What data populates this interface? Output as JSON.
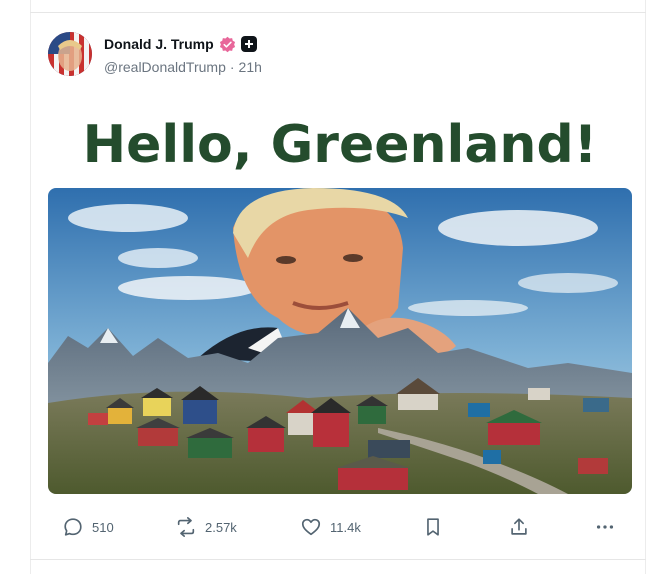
{
  "post": {
    "author": {
      "display_name": "Donald J. Trump",
      "handle": "@realDonaldTrump",
      "separator": "·",
      "time": "21h",
      "verified_badge_color": "#e8679a",
      "badges": [
        "verified-icon",
        "plus-badge-icon"
      ]
    },
    "media": {
      "title": "Hello, Greenland!",
      "title_color": "#244c2d",
      "description_icon": "greenland-photo"
    },
    "stats": {
      "replies": "510",
      "reposts": "2.57k",
      "likes": "11.4k"
    },
    "actions": {
      "reply_icon": "comment-icon",
      "repost_icon": "repost-icon",
      "like_icon": "heart-icon",
      "bookmark_icon": "bookmark-icon",
      "share_icon": "share-icon",
      "more_icon": "more-dots-icon"
    }
  }
}
